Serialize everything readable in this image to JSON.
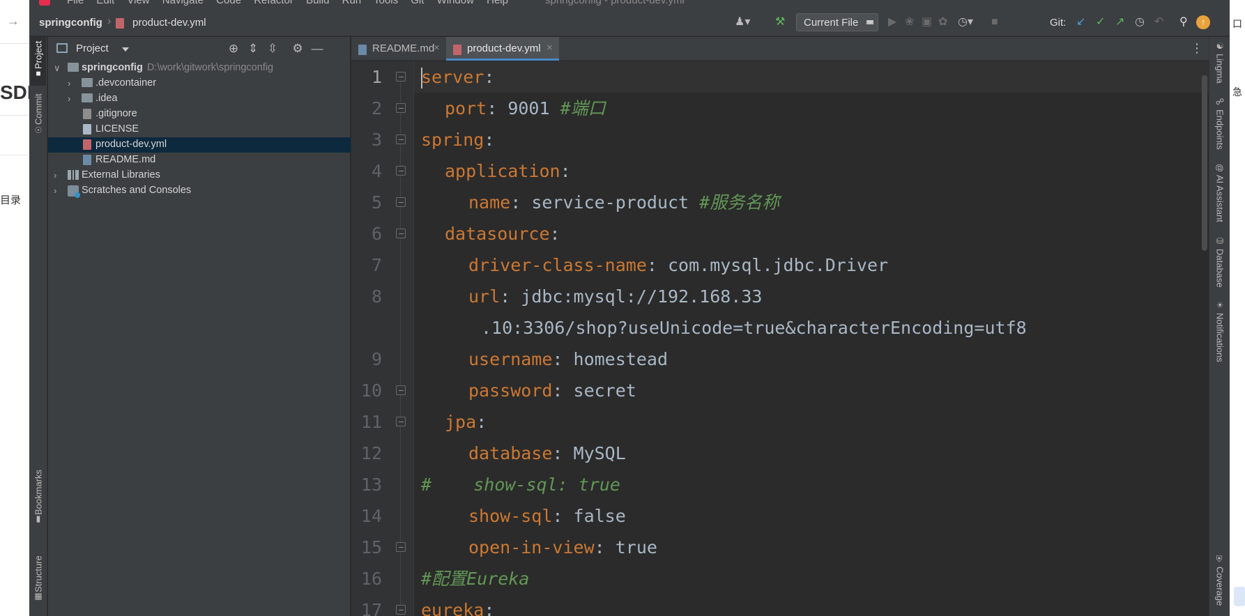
{
  "background": {
    "left_heading": "SDI",
    "left_text": "目录",
    "right_chars": [
      "口",
      "急"
    ]
  },
  "menubar": {
    "items": [
      "File",
      "Edit",
      "View",
      "Navigate",
      "Code",
      "Refactor",
      "Build",
      "Run",
      "Tools",
      "Git",
      "Window",
      "Help"
    ],
    "window_title": "springconfig - product-dev.yml"
  },
  "navbar": {
    "project_crumb": "springconfig",
    "file_crumb": "product-dev.yml",
    "run_config": "Current File",
    "git_label": "Git:"
  },
  "left_strip": {
    "project": "Project",
    "commit": "Commit",
    "bookmarks": "Bookmarks",
    "structure": "Structure"
  },
  "right_strip": {
    "lingma": "Lingma",
    "endpoints": "Endpoints",
    "ai_assistant": "AI Assistant",
    "database": "Database",
    "notifications": "Notifications",
    "coverage": "Coverage"
  },
  "project_panel": {
    "title": "Project",
    "tree": [
      {
        "label": "springconfig",
        "path": "D:\\work\\gitwork\\springconfig"
      },
      {
        "label": ".devcontainer"
      },
      {
        "label": ".idea"
      },
      {
        "label": ".gitignore"
      },
      {
        "label": "LICENSE"
      },
      {
        "label": "product-dev.yml"
      },
      {
        "label": "README.md"
      },
      {
        "label": "External Libraries"
      },
      {
        "label": "Scratches and Consoles"
      }
    ]
  },
  "tabs": [
    {
      "label": "README.md",
      "icon": "md-file-icon"
    },
    {
      "label": "product-dev.yml",
      "icon": "yml-file-icon"
    }
  ],
  "editor": {
    "lines": [
      {
        "n": "1",
        "key": "server",
        "sep": ":",
        "value": "",
        "comment": ""
      },
      {
        "n": "2",
        "key": "port",
        "sep": ": ",
        "value": "9001 ",
        "comment": "#端口"
      },
      {
        "n": "3",
        "key": "spring",
        "sep": ":",
        "value": "",
        "comment": ""
      },
      {
        "n": "4",
        "key": "application",
        "sep": ":",
        "value": "",
        "comment": ""
      },
      {
        "n": "5",
        "key": "name",
        "sep": ": ",
        "value": "service-product ",
        "comment": "#服务名称"
      },
      {
        "n": "6",
        "key": "datasource",
        "sep": ":",
        "value": "",
        "comment": ""
      },
      {
        "n": "7",
        "key": "driver-class-name",
        "sep": ": ",
        "value": "com.mysql.jdbc.Driver",
        "comment": ""
      },
      {
        "n": "8",
        "key": "url",
        "sep": ": ",
        "value": "jdbc:mysql://192.168.33",
        "comment": ""
      },
      {
        "n": "",
        "key": "",
        "sep": "",
        "value": ".10:3306/shop?useUnicode=true&characterEncoding=utf8",
        "comment": ""
      },
      {
        "n": "9",
        "key": "username",
        "sep": ": ",
        "value": "homestead",
        "comment": ""
      },
      {
        "n": "10",
        "key": "password",
        "sep": ": ",
        "value": "secret",
        "comment": ""
      },
      {
        "n": "11",
        "key": "jpa",
        "sep": ":",
        "value": "",
        "comment": ""
      },
      {
        "n": "12",
        "key": "database",
        "sep": ": ",
        "value": "MySQL",
        "comment": ""
      },
      {
        "n": "13",
        "key": "",
        "sep": "",
        "value": "",
        "comment": "#    show-sql: true"
      },
      {
        "n": "14",
        "key": "show-sql",
        "sep": ": ",
        "value": "false",
        "comment": ""
      },
      {
        "n": "15",
        "key": "open-in-view",
        "sep": ": ",
        "value": "true",
        "comment": ""
      },
      {
        "n": "16",
        "key": "",
        "sep": "",
        "value": "",
        "comment": "#配置Eureka"
      },
      {
        "n": "17",
        "key": "eureka",
        "sep": ":",
        "value": "",
        "comment": ""
      }
    ]
  },
  "colors": {
    "key": "#cc7832",
    "comment": "#629755",
    "text": "#a9b7c6",
    "selection": "#0d293e",
    "tab_underline": "#4a88c7"
  }
}
